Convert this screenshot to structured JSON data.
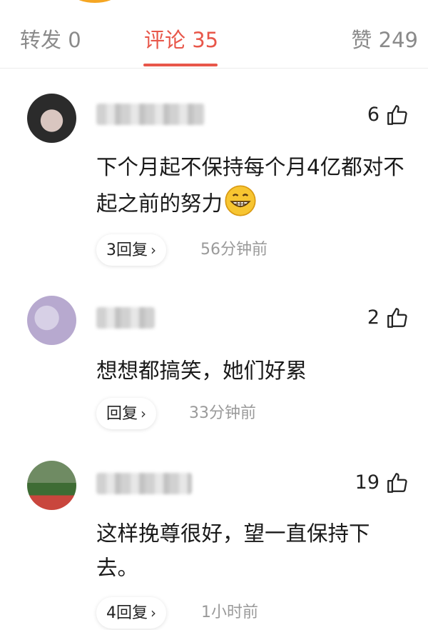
{
  "tabs": {
    "reposts": "转发 0",
    "comments": "评论 35",
    "likes": "赞 249"
  },
  "comments": [
    {
      "like_count": "6",
      "text": "下个月起不保持每个月4亿都对不起之前的努力",
      "emoji": "grinning-face-emoji",
      "reply_label": "3回复",
      "time": "56分钟前"
    },
    {
      "like_count": "2",
      "text": "想想都搞笑，她们好累",
      "reply_label": "回复",
      "time": "33分钟前"
    },
    {
      "like_count": "19",
      "text": "这样挽尊很好，望一直保持下去。",
      "reply_label": "4回复",
      "time": "1小时前"
    }
  ],
  "colors": {
    "accent": "#e8574a",
    "muted": "#8a8a8a",
    "text": "#1a1a1a"
  },
  "icons": {
    "like": "thumb-up-icon",
    "chevron": "chevron-right-icon"
  }
}
